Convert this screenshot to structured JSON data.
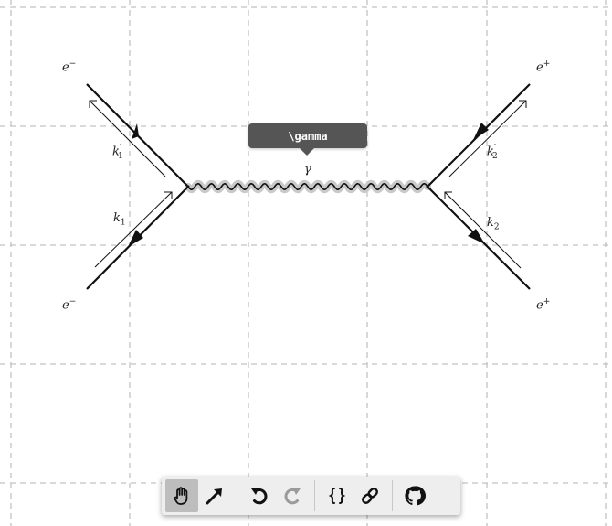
{
  "diagram": {
    "particles": {
      "top_left": "e",
      "top_left_charge": "−",
      "bottom_left": "e",
      "bottom_left_charge": "−",
      "top_right": "e",
      "top_right_charge": "+",
      "bottom_right": "e",
      "bottom_right_charge": "+"
    },
    "momenta": {
      "k1_prime": "k",
      "k1_prime_prime": "′",
      "k1_prime_sub": "1",
      "k1": "k",
      "k1_sub": "1",
      "k2_prime": "k",
      "k2_prime_prime": "′",
      "k2_prime_sub": "2",
      "k2": "k",
      "k2_sub": "2"
    },
    "photon_label": "γ",
    "tooltip_text": "\\gamma"
  },
  "toolbar": {
    "tools": [
      {
        "icon": "hand-icon",
        "active": true
      },
      {
        "icon": "arrow-icon",
        "active": false
      },
      {
        "icon": "undo-icon",
        "enabled": true
      },
      {
        "icon": "redo-icon",
        "enabled": false
      },
      {
        "icon": "braces-icon"
      },
      {
        "icon": "link-icon"
      },
      {
        "icon": "github-icon"
      }
    ]
  },
  "colors": {
    "line": "#111111",
    "grid": "#c2c2c2",
    "photon_highlight": "#c9c9c9",
    "tooltip_bg": "#555555",
    "toolbar_bg": "#eeeeee",
    "active_tool_bg": "#bdbdbd",
    "disabled_icon": "#9a9a9a"
  }
}
